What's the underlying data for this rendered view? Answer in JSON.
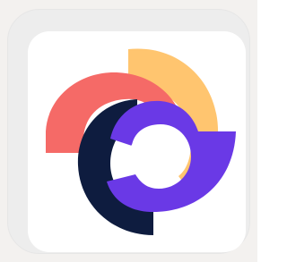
{
  "app_icon": {
    "label": "",
    "colors": {
      "backdrop": "#f3f1ef",
      "tile": "#ededed",
      "face": "#ffffff",
      "yellow_arc": "#ffc56f",
      "coral_arc": "#f56a67",
      "navy_arc": "#0e1c3f",
      "purple_arc": "#6a39e6"
    },
    "logo": {
      "name": "four-color-swirl-logo",
      "arcs": [
        "yellow",
        "coral",
        "navy",
        "purple"
      ]
    }
  }
}
